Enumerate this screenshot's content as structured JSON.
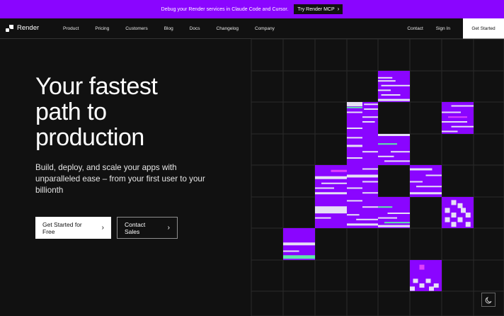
{
  "announcement": {
    "message": "Debug your Render services in Claude Code and Cursor.",
    "cta_label": "Try Render MCP",
    "background": "#8a05ff"
  },
  "nav": {
    "brand": "Render",
    "links": [
      "Product",
      "Pricing",
      "Customers",
      "Blog",
      "Docs",
      "Changelog",
      "Company"
    ],
    "contact": "Contact",
    "sign_in": "Sign In",
    "get_started": "Get Started"
  },
  "hero": {
    "title_lines": [
      "Your fastest",
      "path to",
      "production"
    ],
    "subtitle": "Build, deploy, and scale your apps with unparalleled ease – from your first user to your billionth",
    "primary_button": "Get Started for Free",
    "secondary_button": "Contact Sales"
  },
  "icons": {
    "logo": "render-logo-icon",
    "chevron": "chevron-right-icon",
    "theme": "moon-icon"
  },
  "colors": {
    "accent": "#8a05ff",
    "highlight_pink": "#e040fb",
    "highlight_green": "#5eeaa8",
    "light_bar": "#e6e0f5"
  }
}
